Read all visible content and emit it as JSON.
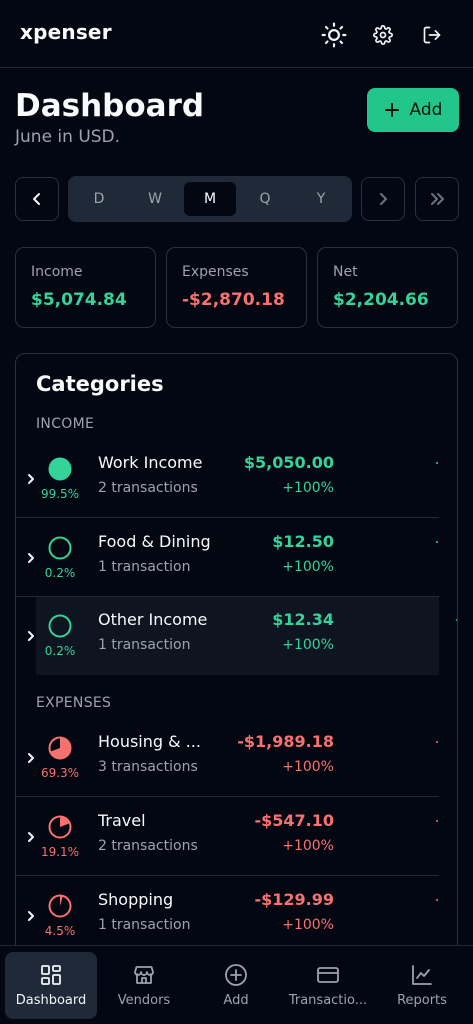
{
  "app": {
    "title": "xpenser"
  },
  "header": {
    "icons": [
      "sun-icon",
      "gear-icon",
      "logout-icon"
    ]
  },
  "page": {
    "title": "Dashboard",
    "subtitle": "June in USD.",
    "add_label": "Add"
  },
  "periods": {
    "options": [
      "D",
      "W",
      "M",
      "Q",
      "Y"
    ],
    "selected": "M"
  },
  "summary": {
    "income": {
      "label": "Income",
      "value": "$5,074.84"
    },
    "expenses": {
      "label": "Expenses",
      "value": "-$2,870.18"
    },
    "net": {
      "label": "Net",
      "value": "$2,204.66"
    }
  },
  "categories": {
    "title": "Categories",
    "income_label": "INCOME",
    "expenses_label": "EXPENSES",
    "income": [
      {
        "name": "Work Income",
        "transactions": "2 transactions",
        "amount": "$5,050.00",
        "change": "+100%",
        "percent_label": "99.5%",
        "share": 0.995
      },
      {
        "name": "Food & Dining",
        "transactions": "1 transaction",
        "amount": "$12.50",
        "change": "+100%",
        "percent_label": "0.2%",
        "share": 0.002
      },
      {
        "name": "Other Income",
        "transactions": "1 transaction",
        "amount": "$12.34",
        "change": "+100%",
        "percent_label": "0.2%",
        "share": 0.002
      }
    ],
    "expenses": [
      {
        "name": "Housing & ...",
        "transactions": "3 transactions",
        "amount": "-$1,989.18",
        "change": "+100%",
        "percent_label": "69.3%",
        "share": 0.693
      },
      {
        "name": "Travel",
        "transactions": "2 transactions",
        "amount": "-$547.10",
        "change": "+100%",
        "percent_label": "19.1%",
        "share": 0.191
      },
      {
        "name": "Shopping",
        "transactions": "1 transaction",
        "amount": "-$129.99",
        "change": "+100%",
        "percent_label": "4.5%",
        "share": 0.045
      }
    ]
  },
  "bottom_nav": [
    {
      "label": "Dashboard",
      "icon": "grid-icon",
      "active": true
    },
    {
      "label": "Vendors",
      "icon": "store-icon"
    },
    {
      "label": "Add",
      "icon": "plus-circle-icon"
    },
    {
      "label": "Transactio...",
      "icon": "card-icon"
    },
    {
      "label": "Reports",
      "icon": "chart-icon"
    }
  ],
  "colors": {
    "accent": "#22c58b",
    "income": "#34d399",
    "expense": "#f87171",
    "background": "#030712"
  }
}
